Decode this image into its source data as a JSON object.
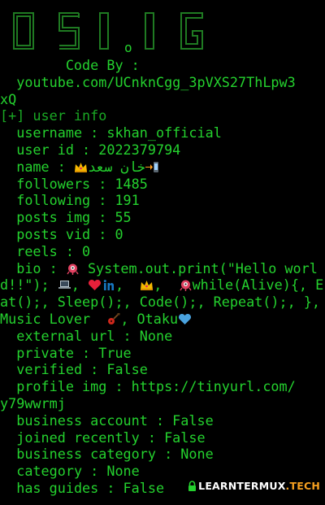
{
  "banner": {
    "letters": [
      "O",
      "S",
      "I",
      "I",
      "G"
    ],
    "small_letter": "o"
  },
  "lines": {
    "credit_label": "Code By :",
    "credit_url_1": "youtube.com/UCnknCgg_3pVXS27ThLpw3",
    "credit_url_2": "xQ",
    "section_header": "[+] user info",
    "username": "username : skhan_official",
    "user_id": "user id : 2022379794",
    "name_label": "name : ",
    "name_value": "خان سعد",
    "followers": "followers : 1485",
    "following": "following : 191",
    "posts_img": "posts img : 55",
    "posts_vid": "posts vid : 0",
    "reels": "reels : 0",
    "bio_prefix": "bio : ",
    "bio_t1": " System.out.print(\"Hello world!!\"); ",
    "bio_t2": ", ",
    "bio_t3": ",  ",
    "bio_t4": "while(Alive){, Eat();, Sleep();, Code();, Repeat();, },  Music Lover  ",
    "bio_t5": ", Otaku",
    "external_url": "external url : None",
    "private": "private : True",
    "verified": "verified : False",
    "profile_img_1": "profile img : https://tinyurl.com/",
    "profile_img_2": "y79wwrmj",
    "business_account": "business account : False",
    "joined_recently": "joined recently : False",
    "business_category": "business category : None",
    "category": "category : None",
    "has_guides": "has guides : False"
  },
  "watermark": {
    "part1": "LEARNTERMUX",
    "part2": ".TECH"
  },
  "colors": {
    "background": "#000000",
    "text": "#24d12e",
    "banner": "#1f7a22",
    "watermark_accent": "#f5a020"
  },
  "icons": [
    "alien-icon",
    "laptop-icon",
    "heart-icon",
    "linkedin-icon",
    "crown-icon",
    "arrow-phone-icon",
    "guitar-icon",
    "blue-heart-icon",
    "lock-icon"
  ]
}
